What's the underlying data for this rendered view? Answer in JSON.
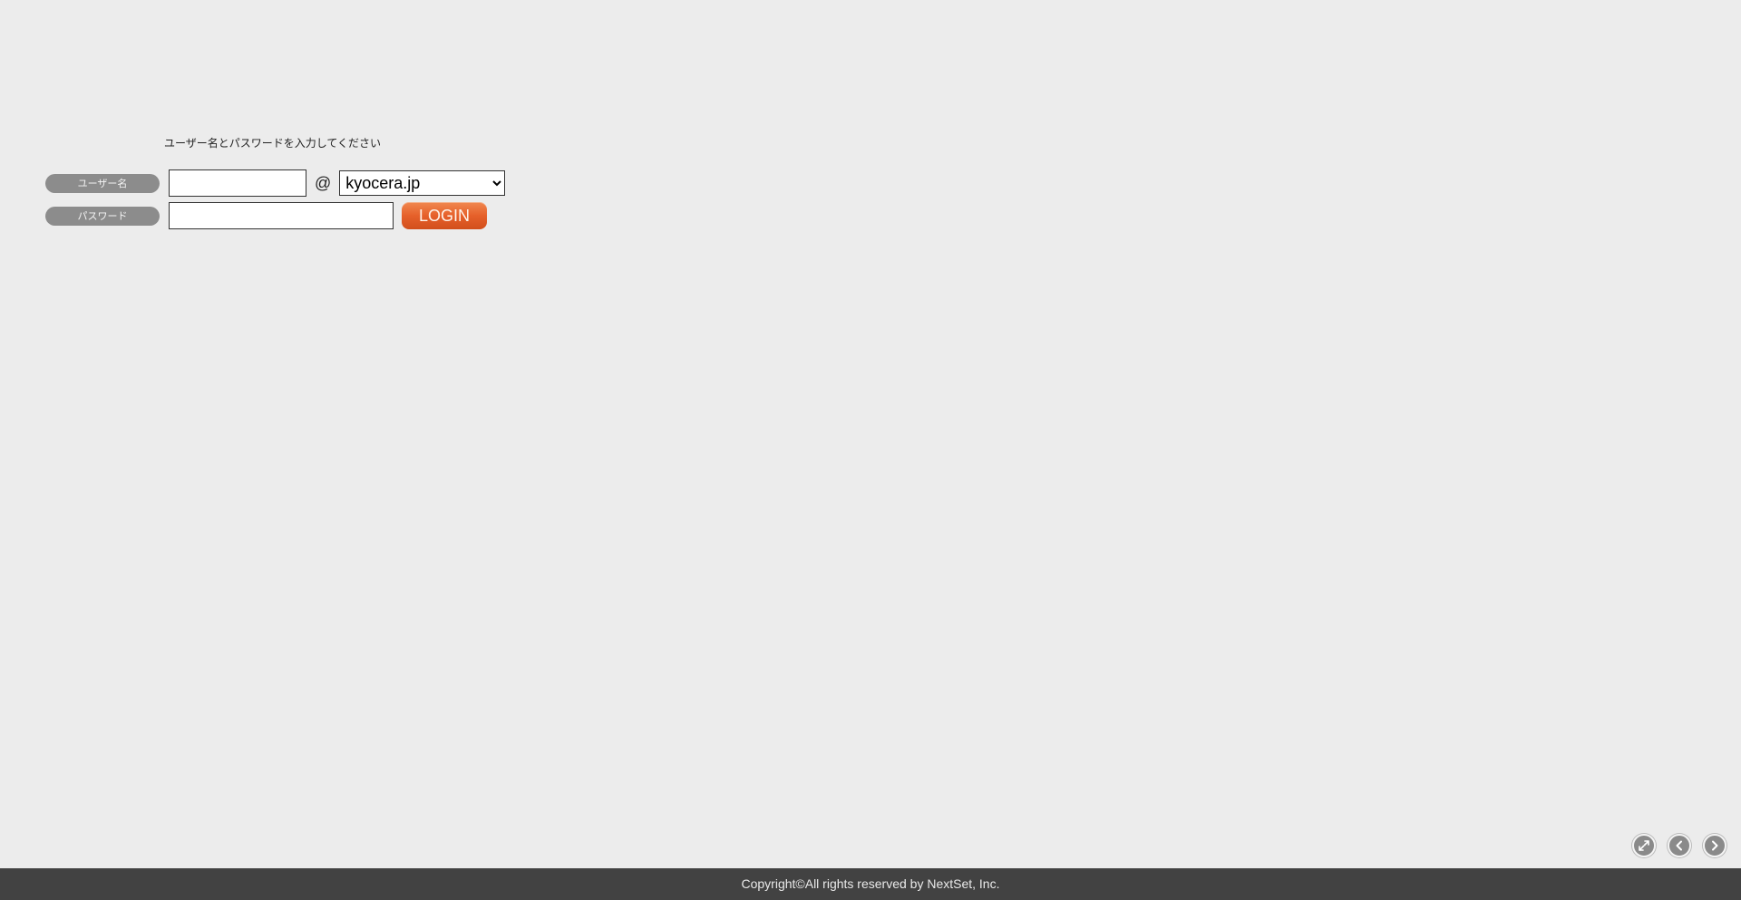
{
  "login": {
    "instruction": "ユーザー名とパスワードを入力してください",
    "username_label": "ユーザー名",
    "password_label": "パスワード",
    "username_value": "",
    "at_symbol": "@",
    "domain_selected": "kyocera.jp",
    "password_value": "",
    "login_button": "LOGIN",
    "login_button_color": "#e6602a"
  },
  "nav": {
    "icons": [
      "expand-icon",
      "chevron-left-icon",
      "chevron-right-icon"
    ]
  },
  "footer": {
    "copyright": "Copyright©All rights reserved by NextSet, Inc."
  },
  "colors": {
    "background": "#ececec",
    "label_pill": "#8c8c8c",
    "footer_bg": "#424242"
  }
}
